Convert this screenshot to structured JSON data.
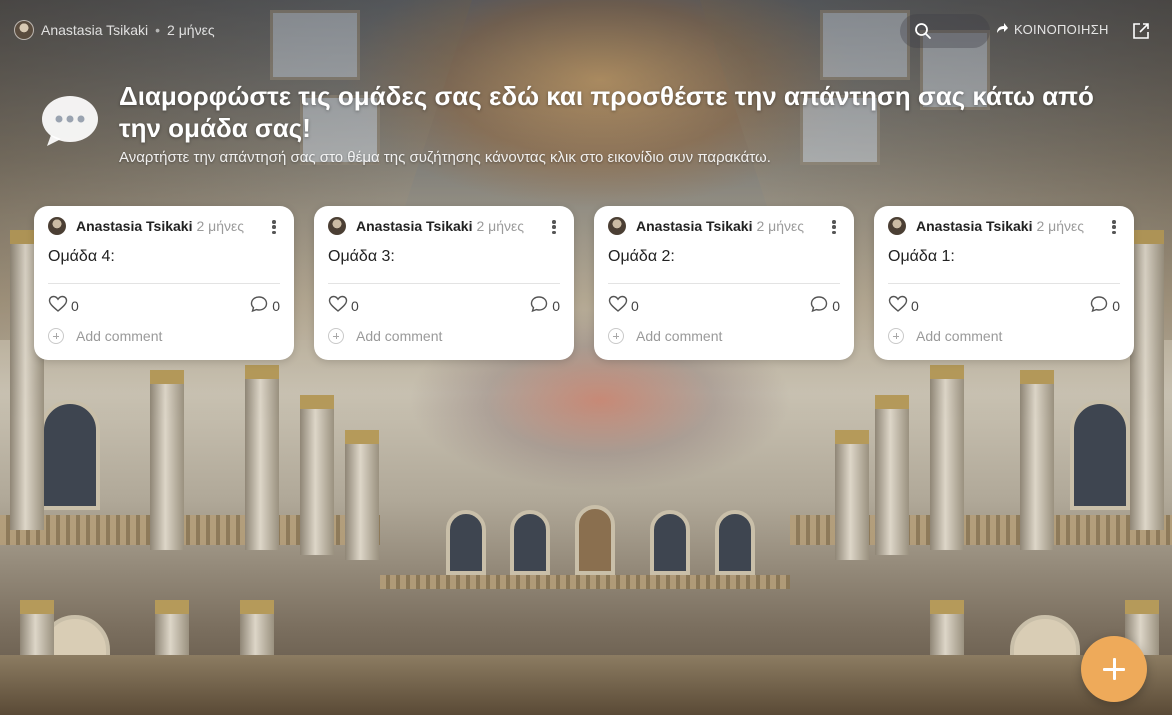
{
  "topbar": {
    "author": "Anastasia Tsikaki",
    "separator": "•",
    "time": "2 μήνες",
    "share_label": "ΚΟΙΝΟΠΟΙΗΣΗ",
    "icons": [
      "search-icon",
      "share-arrow-icon",
      "external-link-icon"
    ]
  },
  "header": {
    "title": "Διαμορφώστε τις ομάδες σας εδώ και προσθέστε την απάντηση σας κάτω από την ομάδα σας!",
    "subtitle": "Αναρτήστε την απάντησή σας στο θέμα της συζήτησης κάνοντας κλικ στο εικονίδιο συν παρακάτω.",
    "icon": "chat-bubble-icon"
  },
  "cards": [
    {
      "author": "Anastasia Tsikaki",
      "time": "2 μήνες",
      "body": "Ομάδα 4:",
      "likes": "0",
      "comments": "0",
      "add_comment": "Add comment"
    },
    {
      "author": "Anastasia Tsikaki",
      "time": "2 μήνες",
      "body": "Ομάδα 3:",
      "likes": "0",
      "comments": "0",
      "add_comment": "Add comment"
    },
    {
      "author": "Anastasia Tsikaki",
      "time": "2 μήνες",
      "body": "Ομάδα 2:",
      "likes": "0",
      "comments": "0",
      "add_comment": "Add comment"
    },
    {
      "author": "Anastasia Tsikaki",
      "time": "2 μήνες",
      "body": "Ομάδα 1:",
      "likes": "0",
      "comments": "0",
      "add_comment": "Add comment"
    }
  ],
  "fab": {
    "icon": "plus-icon",
    "color": "#eeaa5a"
  }
}
